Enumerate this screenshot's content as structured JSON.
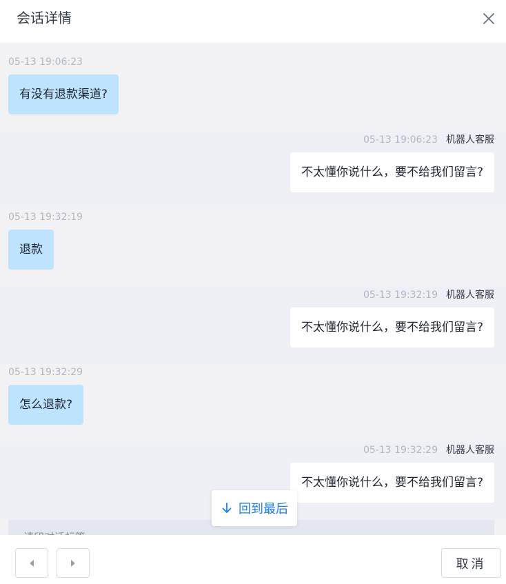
{
  "dialog": {
    "title": "会话详情",
    "close_icon": "close-icon"
  },
  "messages": [
    {
      "role": "user",
      "time": "05-13 19:06:23",
      "text": "有没有退款渠道?"
    },
    {
      "role": "bot",
      "time": "05-13 19:06:23",
      "agent": "机器人客服",
      "text": "不太懂你说什么，要不给我们留言?"
    },
    {
      "role": "user",
      "time": "05-13 19:32:19",
      "text": "退款"
    },
    {
      "role": "bot",
      "time": "05-13 19:32:19",
      "agent": "机器人客服",
      "text": "不太懂你说什么，要不给我们留言?"
    },
    {
      "role": "user",
      "time": "05-13 19:32:29",
      "text": "怎么退款?"
    },
    {
      "role": "bot",
      "time": "05-13 19:32:29",
      "agent": "机器人客服",
      "text": "不太懂你说什么，要不给我们留言?"
    }
  ],
  "tags_area": {
    "label": "请印对话标签"
  },
  "back_to_latest": {
    "label": "回到最后",
    "icon": "arrow-down-icon"
  },
  "footer": {
    "prev_icon": "chevron-left-icon",
    "next_icon": "chevron-right-icon",
    "cancel_label": "取消"
  },
  "colors": {
    "user_bubble": "#bde3fe",
    "bot_bubble": "#ffffff",
    "accent": "#1a7df0",
    "chat_bg": "#f2f2f5"
  }
}
